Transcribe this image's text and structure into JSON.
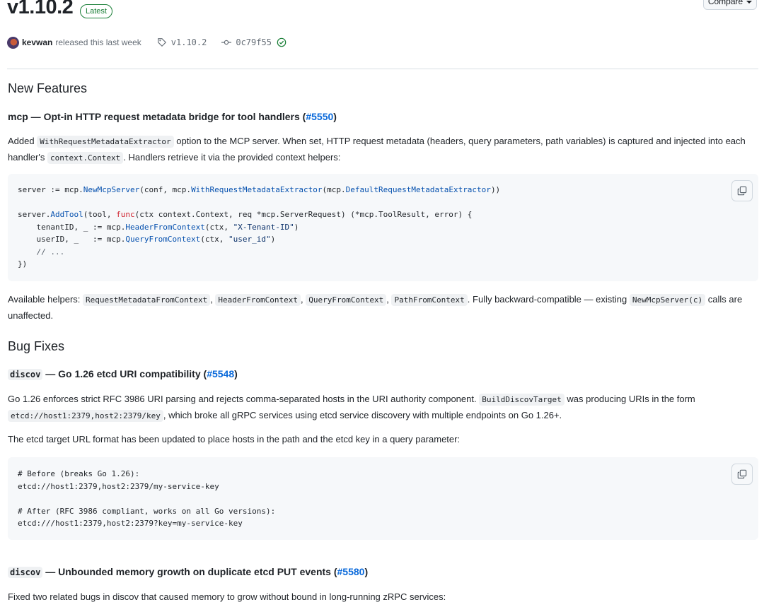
{
  "release": {
    "version": "v1.10.2",
    "latest_badge": "Latest",
    "compare_label": "Compare",
    "author": "kevwan",
    "released_text": "released this last week",
    "tag": "v1.10.2",
    "commit": "0c79f55"
  },
  "features": {
    "heading": "New Features",
    "item_title": "mcp — Opt-in HTTP request metadata bridge for tool handlers (",
    "item_issue": "#5550",
    "item_close": ")",
    "para1_a": "Added ",
    "para1_code1": "WithRequestMetadataExtractor",
    "para1_b": " option to the MCP server. When set, HTTP request metadata (headers, query parameters, path variables) is captured and injected into each handler's ",
    "para1_code2": "context.Context",
    "para1_c": ". Handlers retrieve it via the provided context helpers:",
    "code": {
      "l1_a": "server ",
      "l1_b": ":= mcp.",
      "l1_fn1": "NewMcpServer",
      "l1_c": "(conf, mcp.",
      "l1_fn2": "WithRequestMetadataExtractor",
      "l1_d": "(mcp.",
      "l1_fn3": "DefaultRequestMetadataExtractor",
      "l1_e": "))",
      "l3_a": "server.",
      "l3_fn": "AddTool",
      "l3_b": "(tool, ",
      "l3_kw": "func",
      "l3_c": "(ctx context.Context, req *mcp.ServerRequest) (*mcp.ToolResult, error) {",
      "l4_a": "    tenantID, _ := mcp.",
      "l4_fn": "HeaderFromContext",
      "l4_b": "(ctx, ",
      "l4_str": "\"X-Tenant-ID\"",
      "l4_c": ")",
      "l5_a": "    userID, _   := mcp.",
      "l5_fn": "QueryFromContext",
      "l5_b": "(ctx, ",
      "l5_str": "\"user_id\"",
      "l5_c": ")",
      "l6": "    // ...",
      "l7": "})"
    },
    "para2_a": "Available helpers: ",
    "helper1": "RequestMetadataFromContext",
    "helper2": "HeaderFromContext",
    "helper3": "QueryFromContext",
    "helper4": "PathFromContext",
    "sep": ", ",
    "para2_b": ". Fully backward-compatible — existing ",
    "para2_code": "NewMcpServer(c)",
    "para2_c": " calls are unaffected."
  },
  "bugfixes": {
    "heading": "Bug Fixes",
    "item1_code": "discov",
    "item1_title": " — Go 1.26 etcd URI compatibility (",
    "item1_issue": "#5548",
    "item1_close": ")",
    "para1_a": "Go 1.26 enforces strict RFC 3986 URI parsing and rejects comma-separated hosts in the URI authority component. ",
    "para1_code1": "BuildDiscovTarget",
    "para1_b": " was producing URIs in the form ",
    "para1_code2": "etcd://host1:2379,host2:2379/key",
    "para1_c": ", which broke all gRPC services using etcd service discovery with multiple endpoints on Go 1.26+.",
    "para2": "The etcd target URL format has been updated to place hosts in the path and the etcd key in a query parameter:",
    "code": {
      "l1": "# Before (breaks Go 1.26):",
      "l2": "etcd://host1:2379,host2:2379/my-service-key",
      "l4": "# After (RFC 3986 compliant, works on all Go versions):",
      "l5": "etcd:///host1:2379,host2:2379?key=my-service-key"
    },
    "item2_code": "discov",
    "item2_title": " — Unbounded memory growth on duplicate etcd PUT events (",
    "item2_issue": "#5580",
    "item2_close": ")",
    "para3": "Fixed two related bugs in discov that caused memory to grow without bound in long-running zRPC services:"
  }
}
